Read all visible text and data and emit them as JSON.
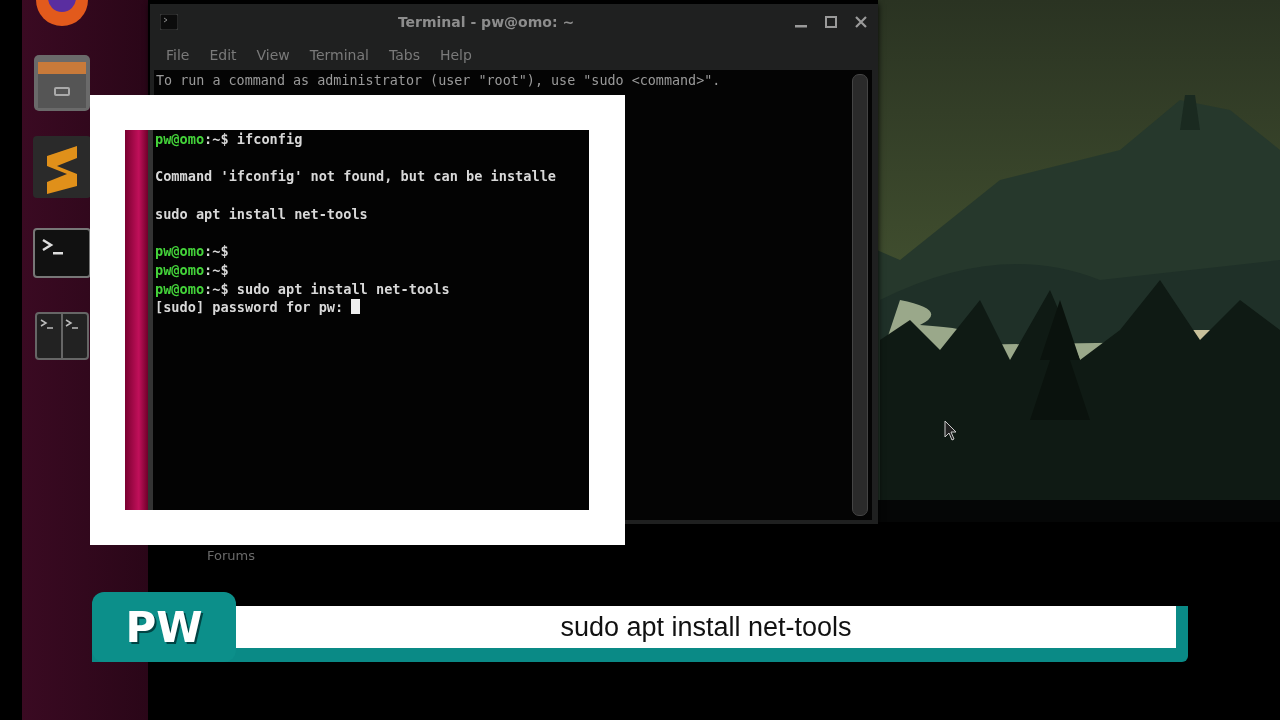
{
  "terminal_window": {
    "title": "Terminal - pw@omo: ~",
    "menu": [
      "File",
      "Edit",
      "View",
      "Terminal",
      "Tabs",
      "Help"
    ],
    "lines": [
      "To run a command as administrator (user \"root\"), use \"sudo <command>\"."
    ]
  },
  "desktop": {
    "labels": [
      "Forums"
    ]
  },
  "zoom_inset": {
    "lines": [
      {
        "kind": "prompt",
        "host": "pw@omo",
        "rest": ":~$",
        "text": " ifconfig"
      },
      {
        "kind": "blank"
      },
      {
        "kind": "output",
        "text": "Command 'ifconfig' not found, but can be installe"
      },
      {
        "kind": "blank"
      },
      {
        "kind": "output",
        "text": "sudo apt install net-tools"
      },
      {
        "kind": "blank"
      },
      {
        "kind": "prompt",
        "host": "pw@omo",
        "rest": ":~$"
      },
      {
        "kind": "prompt",
        "host": "pw@omo",
        "rest": ":~$"
      },
      {
        "kind": "prompt",
        "host": "pw@omo",
        "rest": ":~$",
        "text": " sudo apt install net-tools"
      },
      {
        "kind": "output",
        "text": "[sudo] password for pw: ",
        "cursor": true
      }
    ]
  },
  "caption": {
    "logo": "PW",
    "text": "sudo apt install net-tools"
  }
}
